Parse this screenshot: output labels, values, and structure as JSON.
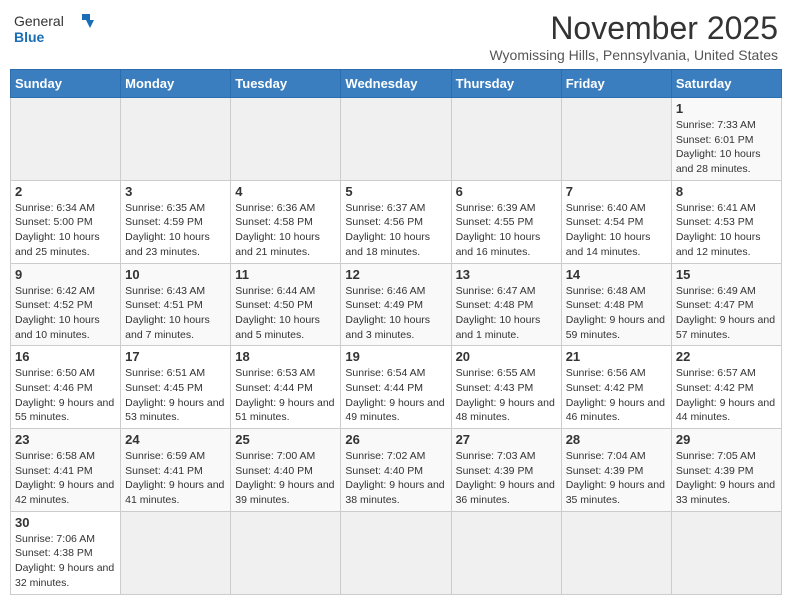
{
  "header": {
    "logo_general": "General",
    "logo_blue": "Blue",
    "month_year": "November 2025",
    "location": "Wyomissing Hills, Pennsylvania, United States"
  },
  "days_of_week": [
    "Sunday",
    "Monday",
    "Tuesday",
    "Wednesday",
    "Thursday",
    "Friday",
    "Saturday"
  ],
  "weeks": [
    [
      {
        "day": "",
        "info": ""
      },
      {
        "day": "",
        "info": ""
      },
      {
        "day": "",
        "info": ""
      },
      {
        "day": "",
        "info": ""
      },
      {
        "day": "",
        "info": ""
      },
      {
        "day": "",
        "info": ""
      },
      {
        "day": "1",
        "info": "Sunrise: 7:33 AM\nSunset: 6:01 PM\nDaylight: 10 hours and 28 minutes."
      }
    ],
    [
      {
        "day": "2",
        "info": "Sunrise: 6:34 AM\nSunset: 5:00 PM\nDaylight: 10 hours and 25 minutes."
      },
      {
        "day": "3",
        "info": "Sunrise: 6:35 AM\nSunset: 4:59 PM\nDaylight: 10 hours and 23 minutes."
      },
      {
        "day": "4",
        "info": "Sunrise: 6:36 AM\nSunset: 4:58 PM\nDaylight: 10 hours and 21 minutes."
      },
      {
        "day": "5",
        "info": "Sunrise: 6:37 AM\nSunset: 4:56 PM\nDaylight: 10 hours and 18 minutes."
      },
      {
        "day": "6",
        "info": "Sunrise: 6:39 AM\nSunset: 4:55 PM\nDaylight: 10 hours and 16 minutes."
      },
      {
        "day": "7",
        "info": "Sunrise: 6:40 AM\nSunset: 4:54 PM\nDaylight: 10 hours and 14 minutes."
      },
      {
        "day": "8",
        "info": "Sunrise: 6:41 AM\nSunset: 4:53 PM\nDaylight: 10 hours and 12 minutes."
      }
    ],
    [
      {
        "day": "9",
        "info": "Sunrise: 6:42 AM\nSunset: 4:52 PM\nDaylight: 10 hours and 10 minutes."
      },
      {
        "day": "10",
        "info": "Sunrise: 6:43 AM\nSunset: 4:51 PM\nDaylight: 10 hours and 7 minutes."
      },
      {
        "day": "11",
        "info": "Sunrise: 6:44 AM\nSunset: 4:50 PM\nDaylight: 10 hours and 5 minutes."
      },
      {
        "day": "12",
        "info": "Sunrise: 6:46 AM\nSunset: 4:49 PM\nDaylight: 10 hours and 3 minutes."
      },
      {
        "day": "13",
        "info": "Sunrise: 6:47 AM\nSunset: 4:48 PM\nDaylight: 10 hours and 1 minute."
      },
      {
        "day": "14",
        "info": "Sunrise: 6:48 AM\nSunset: 4:48 PM\nDaylight: 9 hours and 59 minutes."
      },
      {
        "day": "15",
        "info": "Sunrise: 6:49 AM\nSunset: 4:47 PM\nDaylight: 9 hours and 57 minutes."
      }
    ],
    [
      {
        "day": "16",
        "info": "Sunrise: 6:50 AM\nSunset: 4:46 PM\nDaylight: 9 hours and 55 minutes."
      },
      {
        "day": "17",
        "info": "Sunrise: 6:51 AM\nSunset: 4:45 PM\nDaylight: 9 hours and 53 minutes."
      },
      {
        "day": "18",
        "info": "Sunrise: 6:53 AM\nSunset: 4:44 PM\nDaylight: 9 hours and 51 minutes."
      },
      {
        "day": "19",
        "info": "Sunrise: 6:54 AM\nSunset: 4:44 PM\nDaylight: 9 hours and 49 minutes."
      },
      {
        "day": "20",
        "info": "Sunrise: 6:55 AM\nSunset: 4:43 PM\nDaylight: 9 hours and 48 minutes."
      },
      {
        "day": "21",
        "info": "Sunrise: 6:56 AM\nSunset: 4:42 PM\nDaylight: 9 hours and 46 minutes."
      },
      {
        "day": "22",
        "info": "Sunrise: 6:57 AM\nSunset: 4:42 PM\nDaylight: 9 hours and 44 minutes."
      }
    ],
    [
      {
        "day": "23",
        "info": "Sunrise: 6:58 AM\nSunset: 4:41 PM\nDaylight: 9 hours and 42 minutes."
      },
      {
        "day": "24",
        "info": "Sunrise: 6:59 AM\nSunset: 4:41 PM\nDaylight: 9 hours and 41 minutes."
      },
      {
        "day": "25",
        "info": "Sunrise: 7:00 AM\nSunset: 4:40 PM\nDaylight: 9 hours and 39 minutes."
      },
      {
        "day": "26",
        "info": "Sunrise: 7:02 AM\nSunset: 4:40 PM\nDaylight: 9 hours and 38 minutes."
      },
      {
        "day": "27",
        "info": "Sunrise: 7:03 AM\nSunset: 4:39 PM\nDaylight: 9 hours and 36 minutes."
      },
      {
        "day": "28",
        "info": "Sunrise: 7:04 AM\nSunset: 4:39 PM\nDaylight: 9 hours and 35 minutes."
      },
      {
        "day": "29",
        "info": "Sunrise: 7:05 AM\nSunset: 4:39 PM\nDaylight: 9 hours and 33 minutes."
      }
    ],
    [
      {
        "day": "30",
        "info": "Sunrise: 7:06 AM\nSunset: 4:38 PM\nDaylight: 9 hours and 32 minutes."
      },
      {
        "day": "",
        "info": ""
      },
      {
        "day": "",
        "info": ""
      },
      {
        "day": "",
        "info": ""
      },
      {
        "day": "",
        "info": ""
      },
      {
        "day": "",
        "info": ""
      },
      {
        "day": "",
        "info": ""
      }
    ]
  ]
}
